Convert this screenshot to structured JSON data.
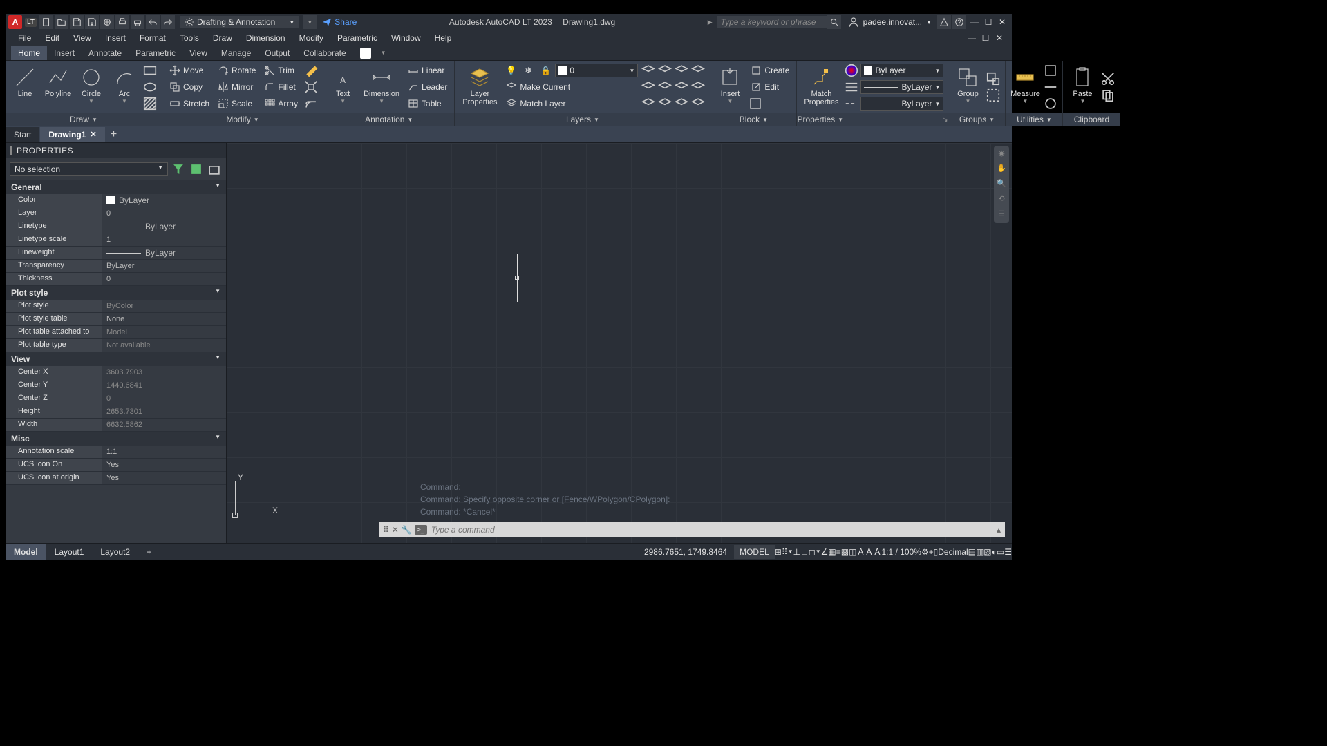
{
  "titlebar": {
    "logo": "A",
    "lt": "LT",
    "workspace": "Drafting & Annotation",
    "share": "Share",
    "app_title": "Autodesk AutoCAD LT 2023",
    "doc_title": "Drawing1.dwg",
    "search_placeholder": "Type a keyword or phrase",
    "user": "padee.innovat..."
  },
  "menu": [
    "File",
    "Edit",
    "View",
    "Insert",
    "Format",
    "Tools",
    "Draw",
    "Dimension",
    "Modify",
    "Parametric",
    "Window",
    "Help"
  ],
  "ribbon_tabs": [
    "Home",
    "Insert",
    "Annotate",
    "Parametric",
    "View",
    "Manage",
    "Output",
    "Collaborate"
  ],
  "ribbon": {
    "draw": {
      "label": "Draw",
      "line": "Line",
      "polyline": "Polyline",
      "circle": "Circle",
      "arc": "Arc"
    },
    "modify": {
      "label": "Modify",
      "move": "Move",
      "rotate": "Rotate",
      "trim": "Trim",
      "copy": "Copy",
      "mirror": "Mirror",
      "fillet": "Fillet",
      "stretch": "Stretch",
      "scale": "Scale",
      "array": "Array"
    },
    "annotation": {
      "label": "Annotation",
      "text": "Text",
      "dimension": "Dimension",
      "linear": "Linear",
      "leader": "Leader",
      "table": "Table"
    },
    "layers": {
      "label": "Layers",
      "properties": "Layer\nProperties",
      "make_current": "Make Current",
      "match": "Match Layer",
      "current": "0"
    },
    "block": {
      "label": "Block",
      "insert": "Insert",
      "create": "Create",
      "edit": "Edit"
    },
    "properties": {
      "label": "Properties",
      "match": "Match\nProperties",
      "bylayer": "ByLayer"
    },
    "groups": {
      "label": "Groups",
      "group": "Group"
    },
    "utilities": {
      "label": "Utilities",
      "measure": "Measure"
    },
    "clipboard": {
      "label": "Clipboard",
      "paste": "Paste"
    }
  },
  "doc_tabs": {
    "start": "Start",
    "d1": "Drawing1"
  },
  "properties_palette": {
    "title": "PROPERTIES",
    "selection": "No selection",
    "sections": {
      "general": "General",
      "plot_style": "Plot style",
      "view": "View",
      "misc": "Misc"
    },
    "rows": {
      "color_k": "Color",
      "color_v": "ByLayer",
      "layer_k": "Layer",
      "layer_v": "0",
      "linetype_k": "Linetype",
      "linetype_v": "ByLayer",
      "ltscale_k": "Linetype scale",
      "ltscale_v": "1",
      "lineweight_k": "Lineweight",
      "lineweight_v": "ByLayer",
      "transparency_k": "Transparency",
      "transparency_v": "ByLayer",
      "thickness_k": "Thickness",
      "thickness_v": "0",
      "plotstyle_k": "Plot style",
      "plotstyle_v": "ByColor",
      "plotstyletable_k": "Plot style table",
      "plotstyletable_v": "None",
      "plottableattached_k": "Plot table attached to",
      "plottableattached_v": "Model",
      "plottabletype_k": "Plot table type",
      "plottabletype_v": "Not available",
      "centerx_k": "Center X",
      "centerx_v": "3603.7903",
      "centery_k": "Center Y",
      "centery_v": "1440.6841",
      "centerz_k": "Center Z",
      "centerz_v": "0",
      "height_k": "Height",
      "height_v": "2653.7301",
      "width_k": "Width",
      "width_v": "6632.5862",
      "annoscale_k": "Annotation scale",
      "annoscale_v": "1:1",
      "ucsicon_k": "UCS icon On",
      "ucsicon_v": "Yes",
      "ucsorigin_k": "UCS icon at origin",
      "ucsorigin_v": "Yes"
    }
  },
  "ucs": {
    "x": "X",
    "y": "Y"
  },
  "command_history": {
    "l1": "Command:",
    "l2": "Command: Specify opposite corner or [Fence/WPolygon/CPolygon]:",
    "l3": "Command: *Cancel*"
  },
  "command_line": {
    "placeholder": "Type a command"
  },
  "layout_tabs": [
    "Model",
    "Layout1",
    "Layout2"
  ],
  "statusbar": {
    "coords": "2986.7651, 1749.8464",
    "model": "MODEL",
    "scale": "1:1 / 100%",
    "units": "Decimal"
  }
}
